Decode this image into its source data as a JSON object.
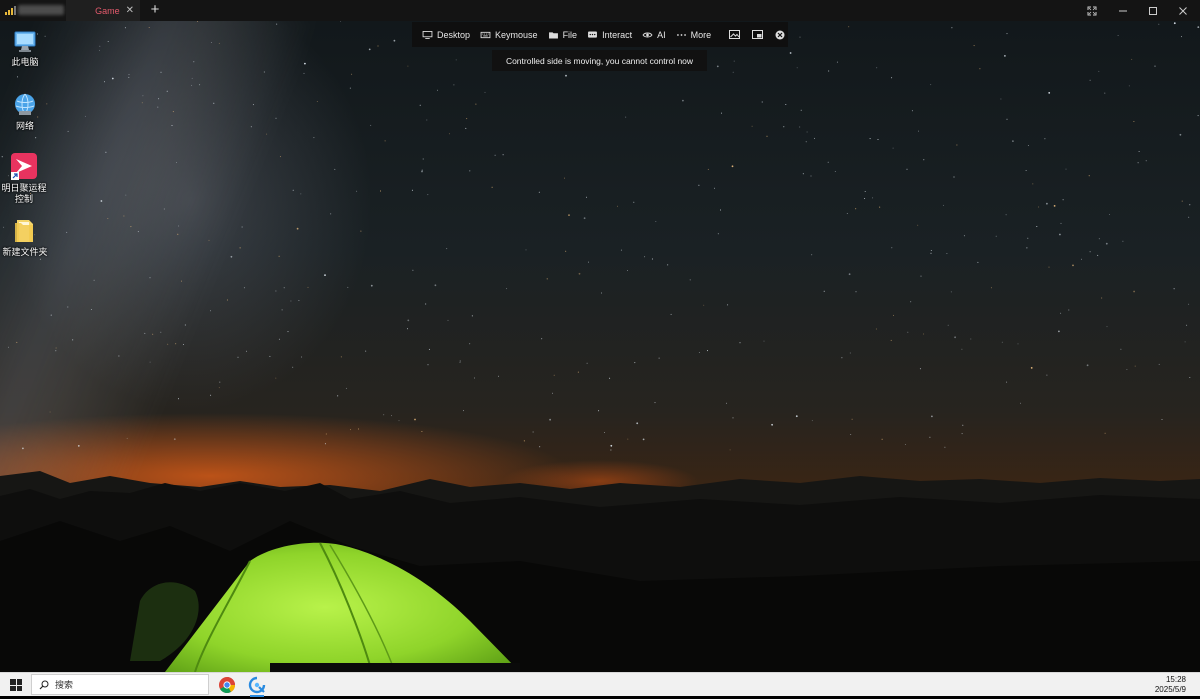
{
  "tabbar": {
    "active_tab_label": "Game",
    "close_glyph": "✕",
    "add_glyph": "+"
  },
  "desktop_icons": [
    {
      "label": "此电脑",
      "icon": "computer-icon"
    },
    {
      "label": "网络",
      "icon": "network-icon"
    },
    {
      "label": "明日聚运程控制",
      "icon": "app-shortcut-icon"
    },
    {
      "label": "新建文件夹",
      "icon": "folder-icon"
    }
  ],
  "toolbar": {
    "items": [
      {
        "label": "Desktop",
        "icon": "monitor-icon"
      },
      {
        "label": "Keymouse",
        "icon": "keyboard-icon"
      },
      {
        "label": "File",
        "icon": "folder-icon"
      },
      {
        "label": "Interact",
        "icon": "chat-icon"
      },
      {
        "label": "AI",
        "icon": "eye-icon"
      },
      {
        "label": "More",
        "icon": "ellipsis-icon"
      }
    ],
    "notice": "Controlled side is moving, you cannot control now"
  },
  "taskbar": {
    "search_label": "搜索",
    "time": "15:28",
    "date": "2025/5/9"
  },
  "colors": {
    "tab_accent": "#e25a6c",
    "tent_green": "#8fd42a",
    "sky_glow": "#d2591a"
  }
}
